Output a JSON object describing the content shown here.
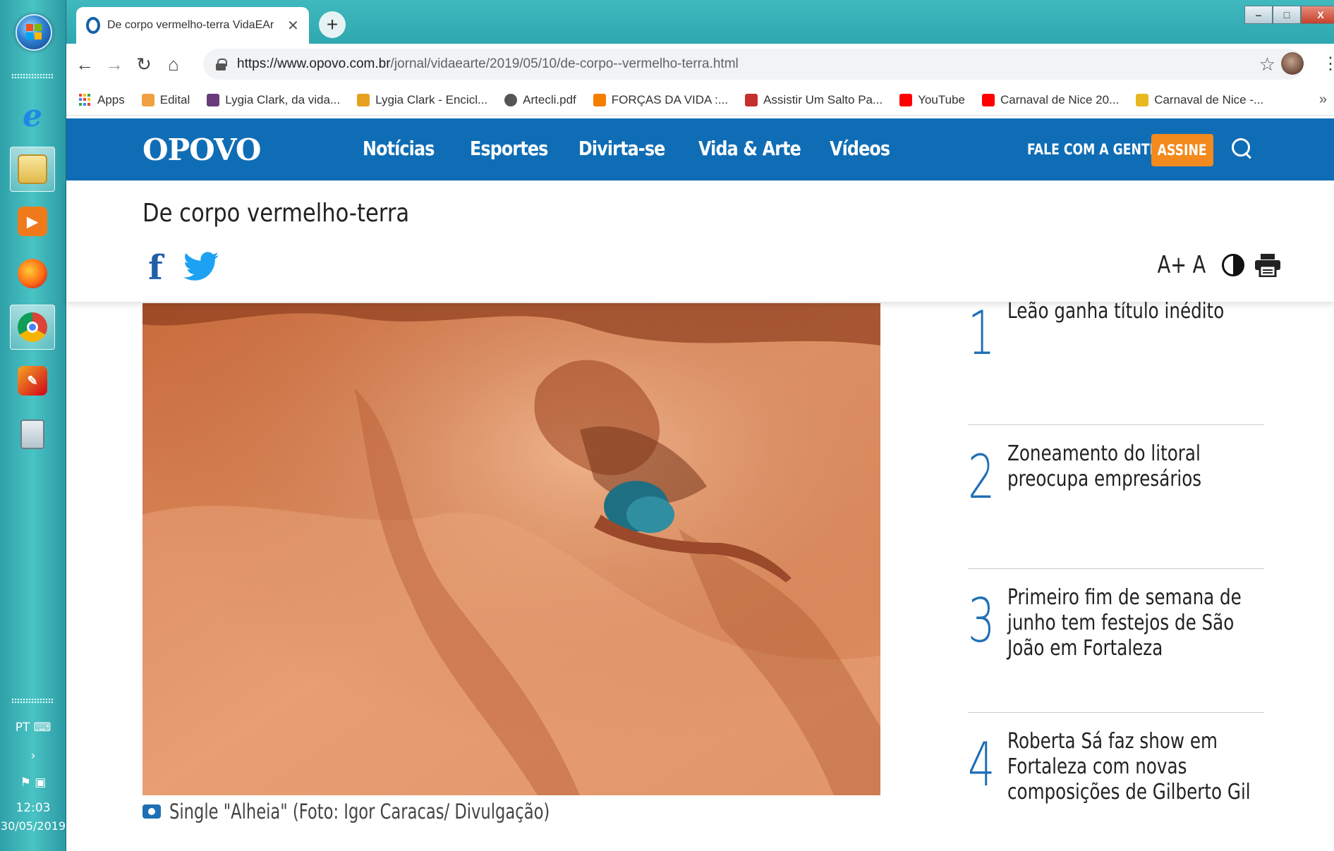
{
  "taskbar": {
    "language": "PT",
    "time": "12:03",
    "date": "30/05/2019"
  },
  "tab": {
    "title": "De corpo vermelho-terra VidaEAr",
    "close": "✕",
    "new_tab": "+"
  },
  "window_controls": {
    "minimize": "‒",
    "maximize": "□",
    "close": "X"
  },
  "toolbar": {
    "back": "←",
    "forward": "→",
    "reload": "↻",
    "home": "⌂",
    "url_host": "https://www.opovo.com.br",
    "url_path": "/jornal/vidaearte/2019/05/10/de-corpo--vermelho-terra.html",
    "star": "☆",
    "menu": "⋮"
  },
  "bookmarks": {
    "items": [
      {
        "label": "Apps",
        "icon": "apps-grid-icon",
        "color": "#4285f4"
      },
      {
        "label": "Edital",
        "icon": "edital-icon",
        "color": "#f0a040"
      },
      {
        "label": "Lygia Clark, da vida...",
        "icon": "lygia-icon",
        "color": "#6a3a7a"
      },
      {
        "label": "Lygia Clark - Encicl...",
        "icon": "enciclopedia-icon",
        "color": "#e6a020"
      },
      {
        "label": "Artecli.pdf",
        "icon": "globe-icon",
        "color": "#555555"
      },
      {
        "label": "FORÇAS DA VIDA :...",
        "icon": "blogger-icon",
        "color": "#f57d00"
      },
      {
        "label": "Assistir Um Salto Pa...",
        "icon": "play-icon",
        "color": "#c4302b"
      },
      {
        "label": "YouTube",
        "icon": "youtube-icon",
        "color": "#ff0000"
      },
      {
        "label": "Carnaval de Nice 20...",
        "icon": "youtube-icon",
        "color": "#ff0000"
      },
      {
        "label": "Carnaval de Nice -...",
        "icon": "crown-icon",
        "color": "#e8b820"
      }
    ],
    "more": "»"
  },
  "site": {
    "logo": "OPOVO",
    "nav": [
      "Notícias",
      "Esportes",
      "Divirta-se",
      "Vida & Arte",
      "Vídeos"
    ],
    "fale": "FALE COM A GENTE",
    "assine": "ASSINE",
    "brand_color": "#0f6db5",
    "accent_color": "#f28a1d"
  },
  "article": {
    "title": "De corpo vermelho-terra",
    "share_facebook": "f",
    "font_increase": "A+",
    "font_normal": "A",
    "caption": "Single \"Alheia\" (Foto: Igor Caracas/ Divulgação)"
  },
  "ranking": [
    {
      "num": "1",
      "text": "Leão ganha título inédito"
    },
    {
      "num": "2",
      "text": "Zoneamento do litoral preocupa empresários"
    },
    {
      "num": "3",
      "text": "Primeiro fim de semana de junho tem festejos de São João em Fortaleza"
    },
    {
      "num": "4",
      "text": "Roberta Sá faz show em Fortaleza com novas composições de Gilberto Gil"
    }
  ]
}
